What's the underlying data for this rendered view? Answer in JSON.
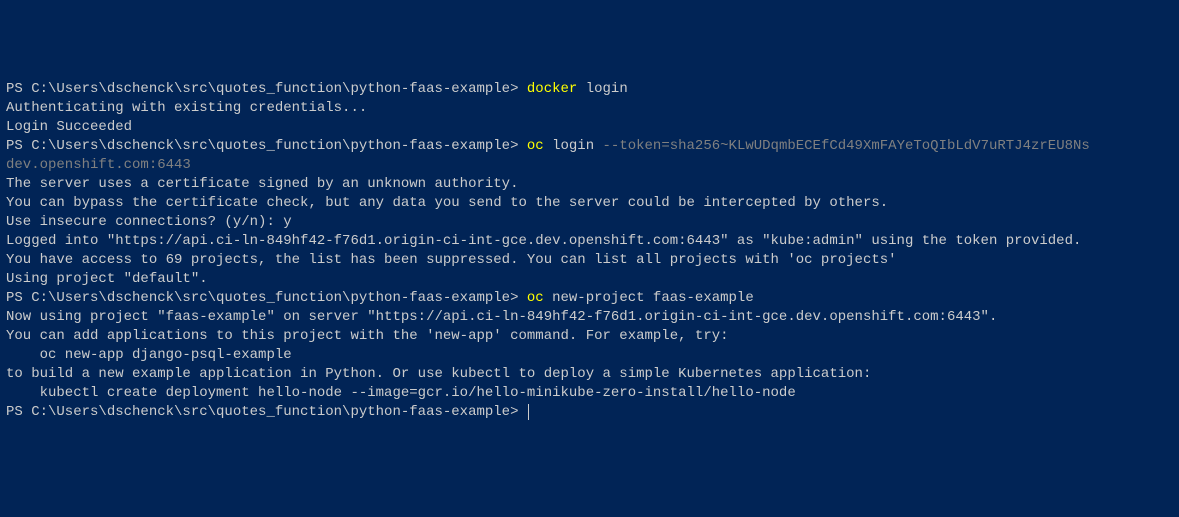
{
  "terminal": {
    "prompt": "PS C:\\Users\\dschenck\\src\\quotes_function\\python-faas-example> ",
    "lines": {
      "l1_cmd1": "docker",
      "l1_cmd2": " login",
      "l2": "Authenticating with existing credentials...",
      "l3": "Login Succeeded",
      "l4_cmd1": "oc",
      "l4_cmd2": " login ",
      "l4_dim": "--token=sha256~KLwUDqmbECEfCd49XmFAYeToQIbLdV7uRTJ4zrEU8Ns ",
      "l5_dim": "dev.openshift.com:6443",
      "l6": "The server uses a certificate signed by an unknown authority.",
      "l7": "You can bypass the certificate check, but any data you send to the server could be intercepted by others.",
      "l8": "Use insecure connections? (y/n): y",
      "l9": "",
      "l10": "Logged into \"https://api.ci-ln-849hf42-f76d1.origin-ci-int-gce.dev.openshift.com:6443\" as \"kube:admin\" using the token provided.",
      "l11": "",
      "l12": "You have access to 69 projects, the list has been suppressed. You can list all projects with 'oc projects'",
      "l13": "",
      "l14": "Using project \"default\".",
      "l15_cmd1": "oc",
      "l15_cmd2": " new-project faas-example",
      "l16": "Now using project \"faas-example\" on server \"https://api.ci-ln-849hf42-f76d1.origin-ci-int-gce.dev.openshift.com:6443\".",
      "l17": "",
      "l18": "You can add applications to this project with the 'new-app' command. For example, try:",
      "l19": "",
      "l20": "    oc new-app django-psql-example",
      "l21": "",
      "l22": "to build a new example application in Python. Or use kubectl to deploy a simple Kubernetes application:",
      "l23": "",
      "l24": "    kubectl create deployment hello-node --image=gcr.io/hello-minikube-zero-install/hello-node",
      "l25": ""
    }
  }
}
